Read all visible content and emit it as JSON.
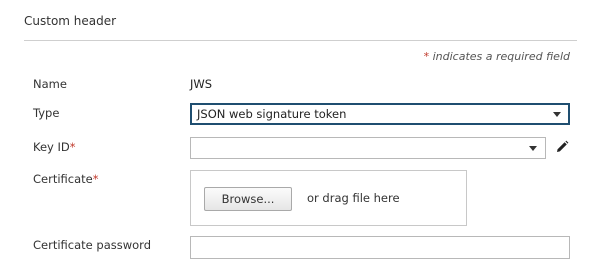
{
  "section": {
    "title": "Custom header"
  },
  "required_note": {
    "star": "*",
    "text": " indicates a required field"
  },
  "form": {
    "name": {
      "label": "Name",
      "value": "JWS"
    },
    "type": {
      "label": "Type",
      "selected": "JSON web signature token"
    },
    "key_id": {
      "label": "Key ID",
      "required_mark": "*",
      "selected": ""
    },
    "certificate": {
      "label": "Certificate",
      "required_mark": "*",
      "browse_label": "Browse...",
      "drag_text": "or drag file here"
    },
    "certificate_password": {
      "label": "Certificate password",
      "value": ""
    }
  },
  "icons": {
    "edit": "pencil-icon",
    "dropdown": "chevron-down-icon"
  },
  "colors": {
    "focus_border": "#1f4e70",
    "required_star": "#c0392b"
  }
}
